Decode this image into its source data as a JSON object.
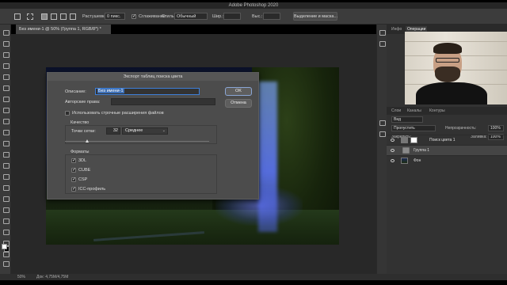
{
  "app": {
    "title": "Adobe Photoshop 2020"
  },
  "options_bar": {
    "feather_label": "Растушевка:",
    "feather_value": "0 пикс.",
    "antialias_label": "Сглаживание",
    "style_label": "Стиль:",
    "style_value": "Обычный",
    "width_label": "Шир.:",
    "height_label": "Выс.:",
    "select_mask_label": "Выделение и маска..."
  },
  "document": {
    "tab": "Без имени-1 @ 50% (Группа 1, RGB/8*) *"
  },
  "status": {
    "zoom": "50%",
    "doc_size": "Док: 4,75M/4,75M"
  },
  "dialog": {
    "title": "Экспорт таблиц поиска цвета",
    "description_label": "Описание:",
    "description_value": "Без имени-1",
    "copyright_label": "Авторские права:",
    "ok_label": "OK",
    "cancel_label": "Отмена",
    "lowercase_ext_label": "Использовать строчные расширения файлов",
    "quality_label": "Качество",
    "grid_points_label": "Точки сетки:",
    "grid_points_value": "32",
    "quality_value": "Среднее",
    "formats_label": "Форматы",
    "formats": [
      "3DL",
      "CUBE",
      "CSP",
      "ICC-профиль"
    ]
  },
  "panels": {
    "tabs": [
      "Инфо",
      "Операции"
    ],
    "layer_tabs": [
      "Слои",
      "Каналы",
      "Контуры"
    ],
    "kind_label": "Вид",
    "blend_mode": "Пропустить",
    "opacity_label": "Непрозрачность:",
    "opacity_value": "100%",
    "lock_label": "Закрепить:",
    "fill_label": "Заливка:",
    "fill_value": "100%",
    "layers": [
      {
        "name": "Поиск цвета 1"
      },
      {
        "name": "Группа 1"
      },
      {
        "name": "Фон"
      }
    ]
  },
  "colors": {
    "accent": "#3d7fd9",
    "panel": "#323232",
    "dialog": "#4c4c4c"
  }
}
